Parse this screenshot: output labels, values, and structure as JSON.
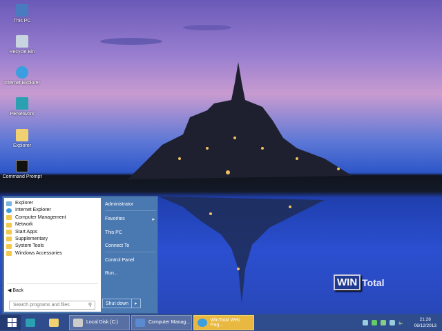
{
  "desktop": {
    "icons": [
      {
        "label": "This PC",
        "icon": "computer-icon"
      },
      {
        "label": "Recycle Bin",
        "icon": "recycle-bin-icon"
      },
      {
        "label": "Internet Explorer",
        "icon": "ie-icon"
      },
      {
        "label": "PENetwork",
        "icon": "network-icon"
      },
      {
        "label": "Explorer",
        "icon": "folder-icon"
      },
      {
        "label": "Command Prompt",
        "icon": "cmd-icon"
      }
    ],
    "watermark": {
      "part1": "WIN",
      "part2": "Total"
    }
  },
  "start_menu": {
    "programs": [
      {
        "label": "Explorer",
        "icon": "explorer-icon"
      },
      {
        "label": "Internet Explorer",
        "icon": "ie-icon"
      },
      {
        "label": "Computer Management",
        "icon": "folder-icon"
      },
      {
        "label": "Network",
        "icon": "folder-icon"
      },
      {
        "label": "Start Apps",
        "icon": "folder-icon"
      },
      {
        "label": "Supplementary",
        "icon": "folder-icon"
      },
      {
        "label": "System Tools",
        "icon": "folder-icon"
      },
      {
        "label": "Windows Accessories",
        "icon": "folder-icon"
      }
    ],
    "back": "Back",
    "search_placeholder": "Search programs and files",
    "right": {
      "user": "Administrator",
      "favorites": "Favorites",
      "this_pc": "This PC",
      "connect_to": "Connect To",
      "control_panel": "Control Panel",
      "run": "Run..."
    },
    "shutdown": "Shut down"
  },
  "taskbar": {
    "tasks": [
      {
        "label": "Local Disk (C:)",
        "active": false
      },
      {
        "label": "Computer Manag...",
        "active": false
      },
      {
        "label": "WinTotal Web Pag...",
        "active": true
      }
    ],
    "time": "21:28",
    "date": "06/12/2013",
    "accent": "#2f4c8c"
  }
}
